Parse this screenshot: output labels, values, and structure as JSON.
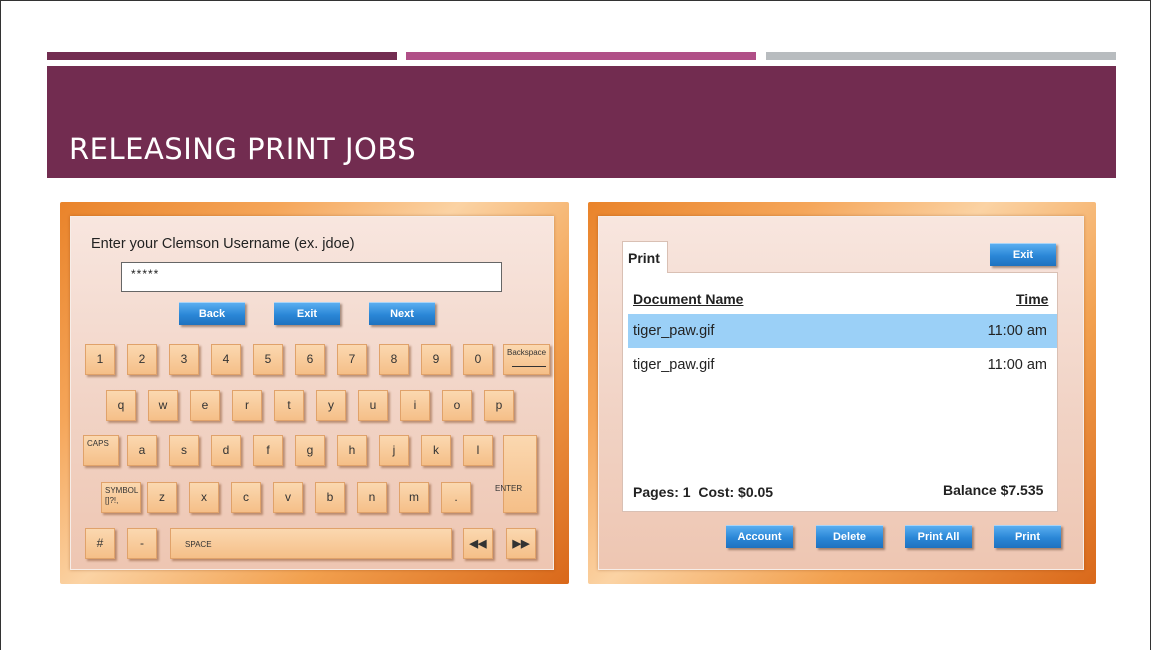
{
  "slide": {
    "title": "RELEASING PRINT JOBS",
    "stripes": [
      "#722c50",
      "#b04f87",
      "#b8bcbf"
    ],
    "banner_color": "#722c50"
  },
  "keyboard_screen": {
    "prompt": "Enter your Clemson Username (ex. jdoe)",
    "username_value": "*****",
    "buttons": {
      "back": "Back",
      "exit": "Exit",
      "next": "Next"
    },
    "row_numbers": [
      "1",
      "2",
      "3",
      "4",
      "5",
      "6",
      "7",
      "8",
      "9",
      "0"
    ],
    "backspace": "Backspace",
    "row_qwerty": [
      "q",
      "w",
      "e",
      "r",
      "t",
      "y",
      "u",
      "i",
      "o",
      "p"
    ],
    "caps": "CAPS",
    "row_home": [
      "a",
      "s",
      "d",
      "f",
      "g",
      "h",
      "j",
      "k",
      "l"
    ],
    "enter": "ENTER",
    "symbol": "SYMBOL []?!,",
    "row_bottom": [
      "z",
      "x",
      "c",
      "v",
      "b",
      "n",
      "m",
      "."
    ],
    "hash": "#",
    "dash": "-",
    "space": "SPACE",
    "rewind_icon": "double-left-arrow",
    "forward_icon": "double-right-arrow"
  },
  "print_screen": {
    "tab": "Print",
    "exit": "Exit",
    "columns": {
      "document": "Document Name",
      "time": "Time"
    },
    "jobs": [
      {
        "name": "tiger_paw.gif",
        "time": "11:00 am",
        "selected": true
      },
      {
        "name": "tiger_paw.gif",
        "time": "11:00 am",
        "selected": false
      }
    ],
    "pages_cost": "Pages: 1  Cost: $0.05",
    "balance": "Balance $7.535",
    "buttons": {
      "account": "Account",
      "delete": "Delete",
      "print_all": "Print All",
      "print": "Print"
    }
  }
}
